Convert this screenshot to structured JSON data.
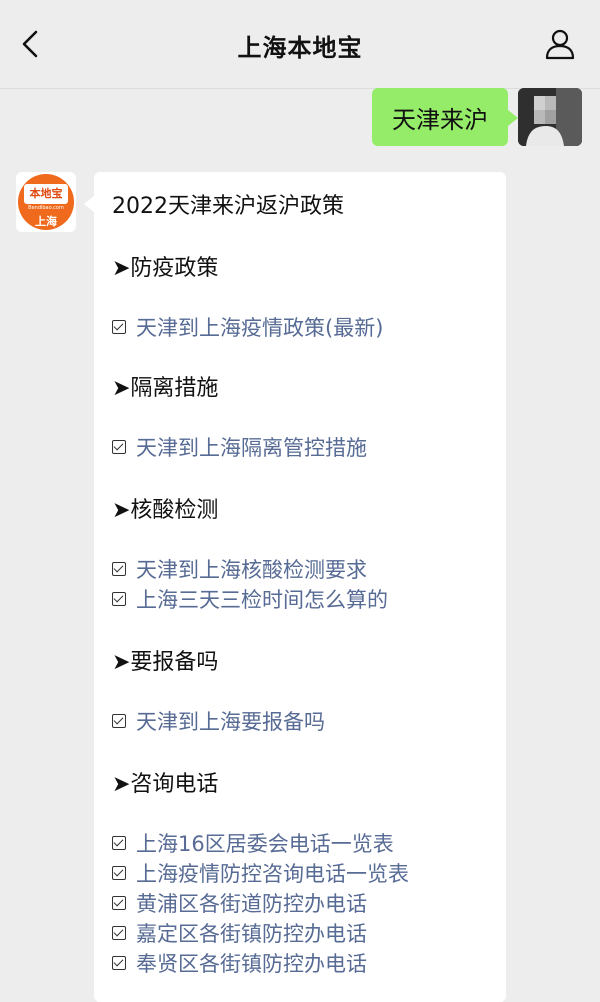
{
  "header": {
    "title": "上海本地宝"
  },
  "my_message": {
    "text": "天津来沪"
  },
  "bot_logo": {
    "brand": "本地宝",
    "sub": "Bendibao.com",
    "city": "上海"
  },
  "reply": {
    "title": "2022天津来沪返沪政策",
    "sections": [
      {
        "heading": "➤防疫政策",
        "links": [
          "天津到上海疫情政策(最新)"
        ]
      },
      {
        "heading": "➤隔离措施",
        "links": [
          "天津到上海隔离管控措施"
        ]
      },
      {
        "heading": "➤核酸检测",
        "links": [
          "天津到上海核酸检测要求",
          "上海三天三检时间怎么算的"
        ]
      },
      {
        "heading": "➤要报备吗",
        "links": [
          "天津到上海要报备吗"
        ]
      },
      {
        "heading": "➤咨询电话",
        "links": [
          "上海16区居委会电话一览表",
          "上海疫情防控咨询电话一览表",
          "黄浦区各街道防控办电话",
          "嘉定区各街镇防控办电话",
          "奉贤区各街镇防控办电话"
        ]
      }
    ]
  },
  "colors": {
    "accent_green": "#95ec69",
    "link_blue": "#576b95",
    "brand_orange": "#f06a1d"
  },
  "icons": {
    "back": "chevron-left-icon",
    "profile": "person-icon",
    "checkbox": "checkbox-icon"
  }
}
